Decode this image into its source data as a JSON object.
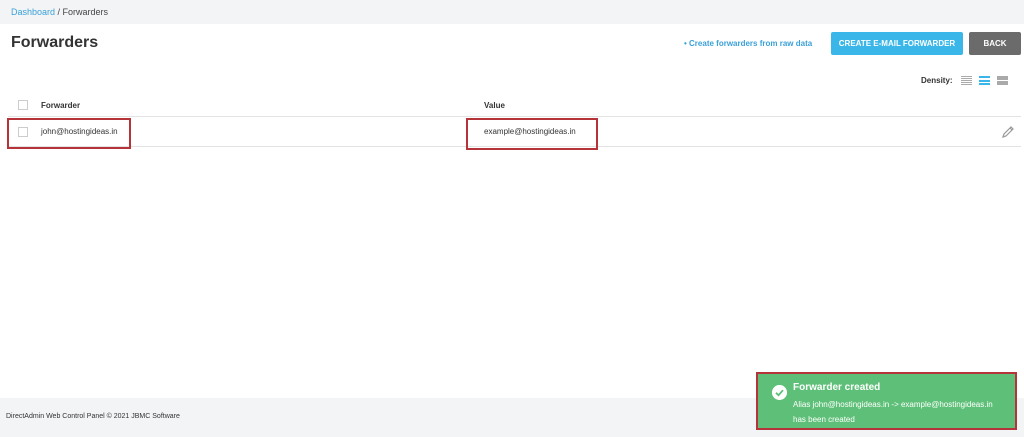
{
  "breadcrumb": {
    "home": "Dashboard",
    "separator": " / ",
    "current": "Forwarders"
  },
  "header": {
    "title": "Forwarders",
    "raw_link": "• Create forwarders from raw data",
    "create_button": "CREATE E-MAIL FORWARDER",
    "back_button": "BACK"
  },
  "density": {
    "label": "Density:",
    "options": [
      "compact",
      "normal",
      "comfortable"
    ],
    "selected": "normal"
  },
  "table": {
    "columns": [
      "Forwarder",
      "Value"
    ],
    "rows": [
      {
        "forwarder": "john@hostingideas.in",
        "value": "example@hostingideas.in"
      }
    ]
  },
  "footer": {
    "text": "DirectAdmin Web Control Panel © 2021 JBMC Software"
  },
  "toast": {
    "title": "Forwarder created",
    "message": "Alias john@hostingideas.in -> example@hostingideas.in has been created",
    "color": "#5ec078"
  },
  "colors": {
    "accent": "#3ab7e8",
    "highlight": "#b5343a",
    "back_button": "#6b6b6b"
  }
}
